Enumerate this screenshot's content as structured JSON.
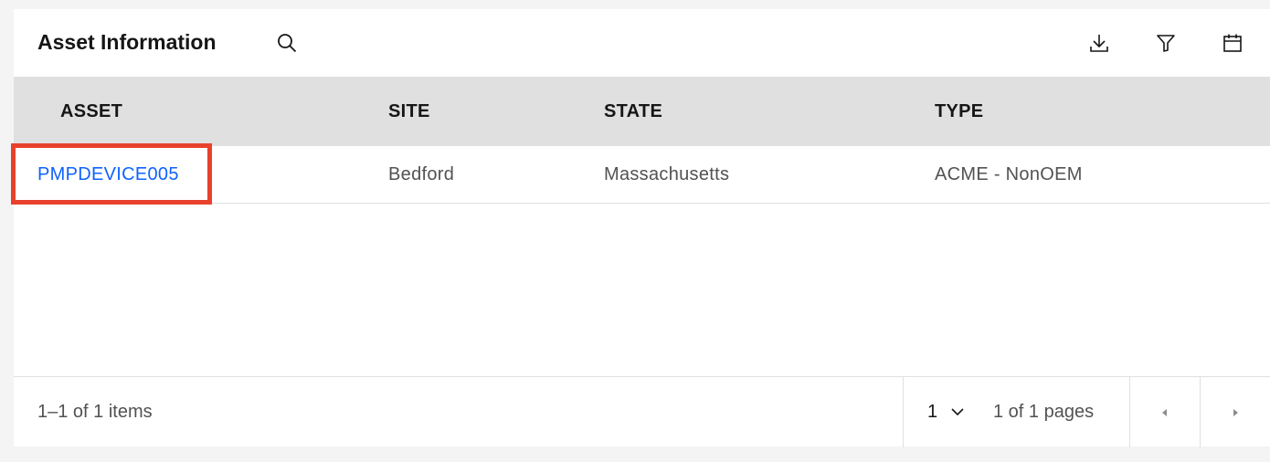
{
  "header": {
    "title": "Asset Information",
    "icons": [
      "search-icon",
      "download-icon",
      "filter-icon",
      "calendar-icon"
    ]
  },
  "table": {
    "columns": [
      "ASSET",
      "SITE",
      "STATE",
      "TYPE"
    ],
    "rows": [
      {
        "asset": "PMPDEVICE005",
        "site": "Bedford",
        "state": "Massachusetts",
        "type": "ACME - NonOEM"
      }
    ]
  },
  "pagination": {
    "items_text": "1–1 of 1 items",
    "current_page": "1",
    "pages_text": "1 of 1 pages"
  },
  "colors": {
    "link": "#0f62fe",
    "highlight": "#e8412c",
    "header_bg": "#e0e0e0"
  }
}
